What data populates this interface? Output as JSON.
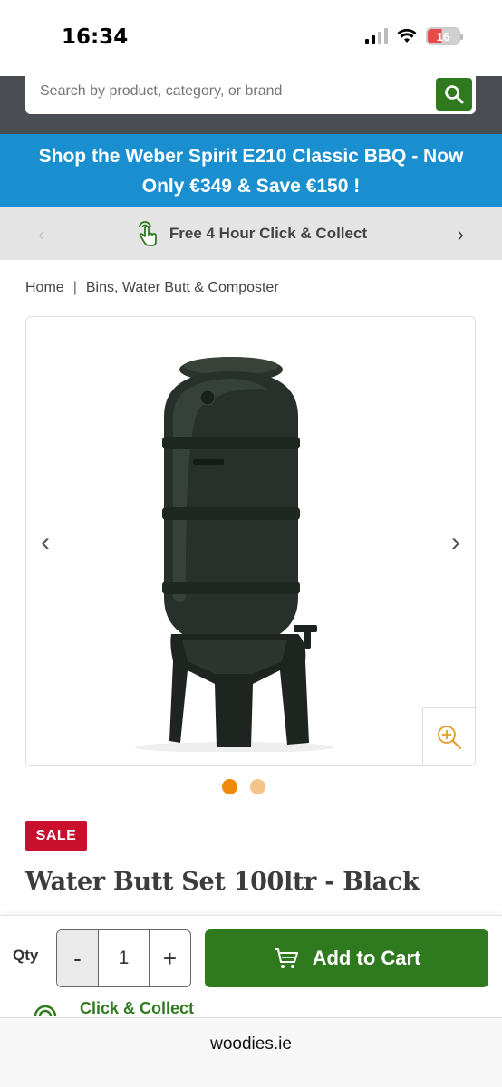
{
  "status_bar": {
    "time": "16:34",
    "battery": "16"
  },
  "search": {
    "placeholder": "Search by product, category, or brand",
    "icon": "search-icon"
  },
  "promo": {
    "text": "Shop the Weber Spirit E210 Classic BBQ - Now Only €349 & Save €150 !"
  },
  "service_strip": {
    "text": "Free 4 Hour Click & Collect",
    "icon": "hand-tap-icon"
  },
  "breadcrumb": {
    "items": [
      "Home",
      "Bins, Water Butt & Composter"
    ],
    "separator": "|"
  },
  "gallery": {
    "image_count": 2,
    "active_index": 0
  },
  "product": {
    "badge": "SALE",
    "title": "Water Butt Set 100ltr - Black"
  },
  "cart": {
    "qty_label": "Qty",
    "qty_minus": "-",
    "qty_value": "1",
    "qty_plus": "+",
    "add_label": "Add to Cart",
    "click_collect": "Click & Collect"
  },
  "browser": {
    "url": "woodies.ie"
  },
  "colors": {
    "brand_green": "#2f7a1f",
    "promo_blue": "#1a8fd0",
    "sale_red": "#c8102e",
    "dot_active": "#ef8a0a",
    "header_grey": "#4a4d52"
  }
}
